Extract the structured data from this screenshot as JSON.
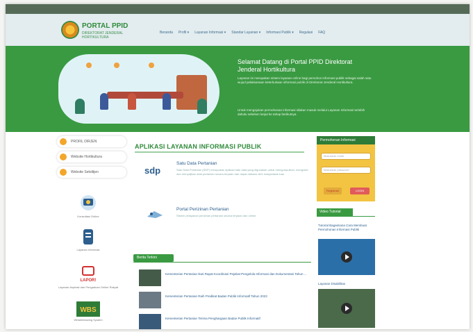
{
  "header": {
    "logo_title": "PORTAL PPID",
    "logo_subtitle": "DIREKTORAT JENDERAL HORTIKULTURA",
    "nav": [
      "Beranda",
      "Profil ▾",
      "Layanan Informasi ▾",
      "Standar Layanan ▾",
      "Informasi Publik ▾",
      "Regulasi",
      "FAQ"
    ]
  },
  "hero": {
    "title": "Selamat Datang di Portal PPID Direktorat Jenderal Hortikultura",
    "text": "Layanan ini merupakan sistem layanan online bagi pemohon informasi publik sebagai salah satu wujud pelaksanaan keterbukaan informasi publik di Direktorat Jenderal Hortikultura.",
    "text2": "Untuk mengajukan permohonan informasi silakan masuk melalui Layanan Informasi terlebih dahulu sebelum lanjut ke tahap berikutnya."
  },
  "left": {
    "pills": [
      "PROFIL DIRJEN",
      "Website Hortikultura",
      "Website Sekditjen"
    ],
    "icons": [
      {
        "name": "video-call-icon",
        "caption": "Konsultasi Online"
      },
      {
        "name": "document-icon",
        "caption": "Layanan Informasi"
      },
      {
        "name": "lapor-icon",
        "caption": "Layanan Aspirasi dan Pengaduan Online Rakyat",
        "label": "LAPOR!"
      },
      {
        "name": "wbs-icon",
        "caption": "Whistleblowing System",
        "label": "WBS"
      }
    ]
  },
  "main": {
    "title": "APLIKASI LAYANAN INFORMASI PUBLIK",
    "apps": [
      {
        "logo": "sdp",
        "title": "Satu Data Pertanian",
        "desc": "Satu Data Pertanian (SDP) merupakan aplikasi satu data yang digunakan untuk mengumpulkan, mengolah dan menyajikan data pertanian secara terpadu dan dapat diakses oleh masyarakat luas."
      },
      {
        "logo": "",
        "title": "Portal Perizinan Pertanian",
        "desc": "Sistem pelayanan perizinan pertanian secara terpadu dan online."
      }
    ],
    "berita_label": "Berita Terkini",
    "news": [
      "Kementerian Pertanian Ikuti Rapat Koordinasi Pejabat Pengelola Informasi dan Dokumentasi Tahun ...",
      "Kementerian Pertanian Raih Predikat Badan Publik Informatif Tahun 2023",
      "Kementerian Pertanian Terima Penghargaan Badan Publik Informatif"
    ]
  },
  "sidebar": {
    "form_title": "Permohonan Informasi",
    "input1": "Masukkan email",
    "input2": "Masukkan password",
    "btn_login": "Registrasi",
    "btn_submit": "LOGIN",
    "video_title": "Video Tutorial",
    "video_caption": "Tutorial Bagaimana Cara Membuat Permohonan Informasi Publik",
    "video_caption2": "Layanan Disabilitas"
  }
}
